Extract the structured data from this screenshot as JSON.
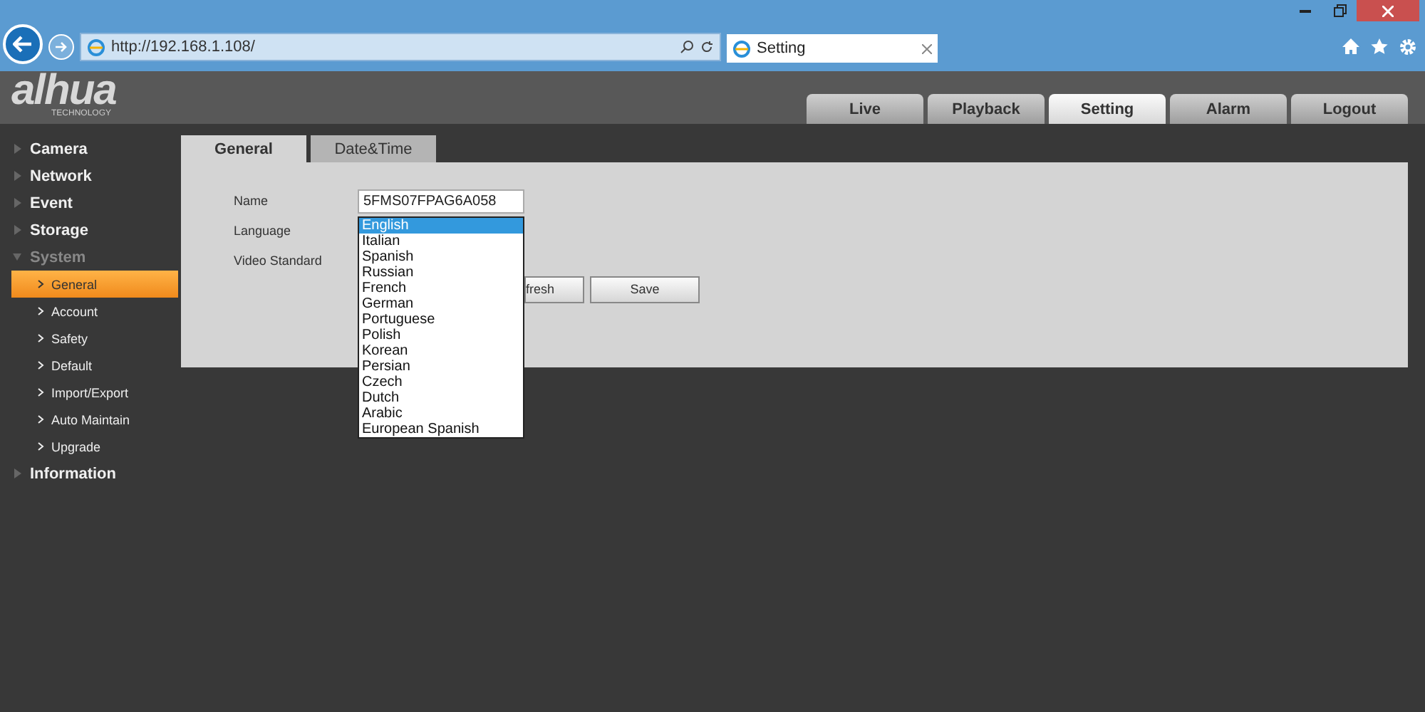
{
  "browser": {
    "address": "http://192.168.1.108/",
    "tab_title": "Setting"
  },
  "logo": {
    "brand": "alhua",
    "tagline": "TECHNOLOGY"
  },
  "nav_tabs": [
    {
      "label": "Live",
      "selected": false
    },
    {
      "label": "Playback",
      "selected": false
    },
    {
      "label": "Setting",
      "selected": true
    },
    {
      "label": "Alarm",
      "selected": false
    },
    {
      "label": "Logout",
      "selected": false
    }
  ],
  "sidebar": {
    "items": [
      {
        "label": "Camera",
        "expanded": false
      },
      {
        "label": "Network",
        "expanded": false
      },
      {
        "label": "Event",
        "expanded": false
      },
      {
        "label": "Storage",
        "expanded": false
      },
      {
        "label": "System",
        "expanded": true,
        "children": [
          {
            "label": "General",
            "selected": true
          },
          {
            "label": "Account",
            "selected": false
          },
          {
            "label": "Safety",
            "selected": false
          },
          {
            "label": "Default",
            "selected": false
          },
          {
            "label": "Import/Export",
            "selected": false
          },
          {
            "label": "Auto Maintain",
            "selected": false
          },
          {
            "label": "Upgrade",
            "selected": false
          }
        ]
      },
      {
        "label": "Information",
        "expanded": false
      }
    ]
  },
  "content_tabs": [
    {
      "label": "General",
      "selected": true
    },
    {
      "label": "Date&Time",
      "selected": false
    }
  ],
  "form": {
    "name_label": "Name",
    "name_value": "5FMS07FPAG6A058",
    "language_label": "Language",
    "video_standard_label": "Video Standard"
  },
  "language_dropdown": {
    "options": [
      {
        "label": "English",
        "selected": true
      },
      {
        "label": "Italian",
        "selected": false
      },
      {
        "label": "Spanish",
        "selected": false
      },
      {
        "label": "Russian",
        "selected": false
      },
      {
        "label": "French",
        "selected": false
      },
      {
        "label": "German",
        "selected": false
      },
      {
        "label": "Portuguese",
        "selected": false
      },
      {
        "label": "Polish",
        "selected": false
      },
      {
        "label": "Korean",
        "selected": false
      },
      {
        "label": "Persian",
        "selected": false
      },
      {
        "label": "Czech",
        "selected": false
      },
      {
        "label": "Dutch",
        "selected": false
      },
      {
        "label": "Arabic",
        "selected": false
      },
      {
        "label": "European Spanish",
        "selected": false
      }
    ]
  },
  "buttons": {
    "refresh": "fresh",
    "save": "Save"
  }
}
